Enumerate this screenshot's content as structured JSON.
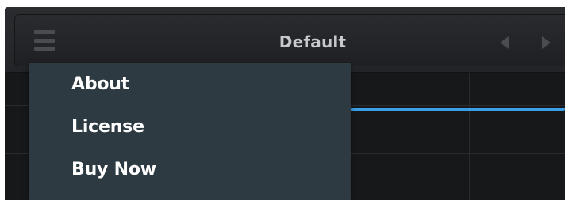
{
  "header": {
    "preset_name": "Default",
    "menu_icon": "hamburger-menu-icon",
    "prev_icon": "chevron-left-icon",
    "next_icon": "chevron-right-icon"
  },
  "menu": {
    "items": [
      {
        "label": "About"
      },
      {
        "label": "License"
      },
      {
        "label": "Buy Now"
      }
    ]
  },
  "colors": {
    "accent_line": "#3a9fe6",
    "menu_background": "#2e3a42",
    "panel_background": "#1c1d1f"
  }
}
